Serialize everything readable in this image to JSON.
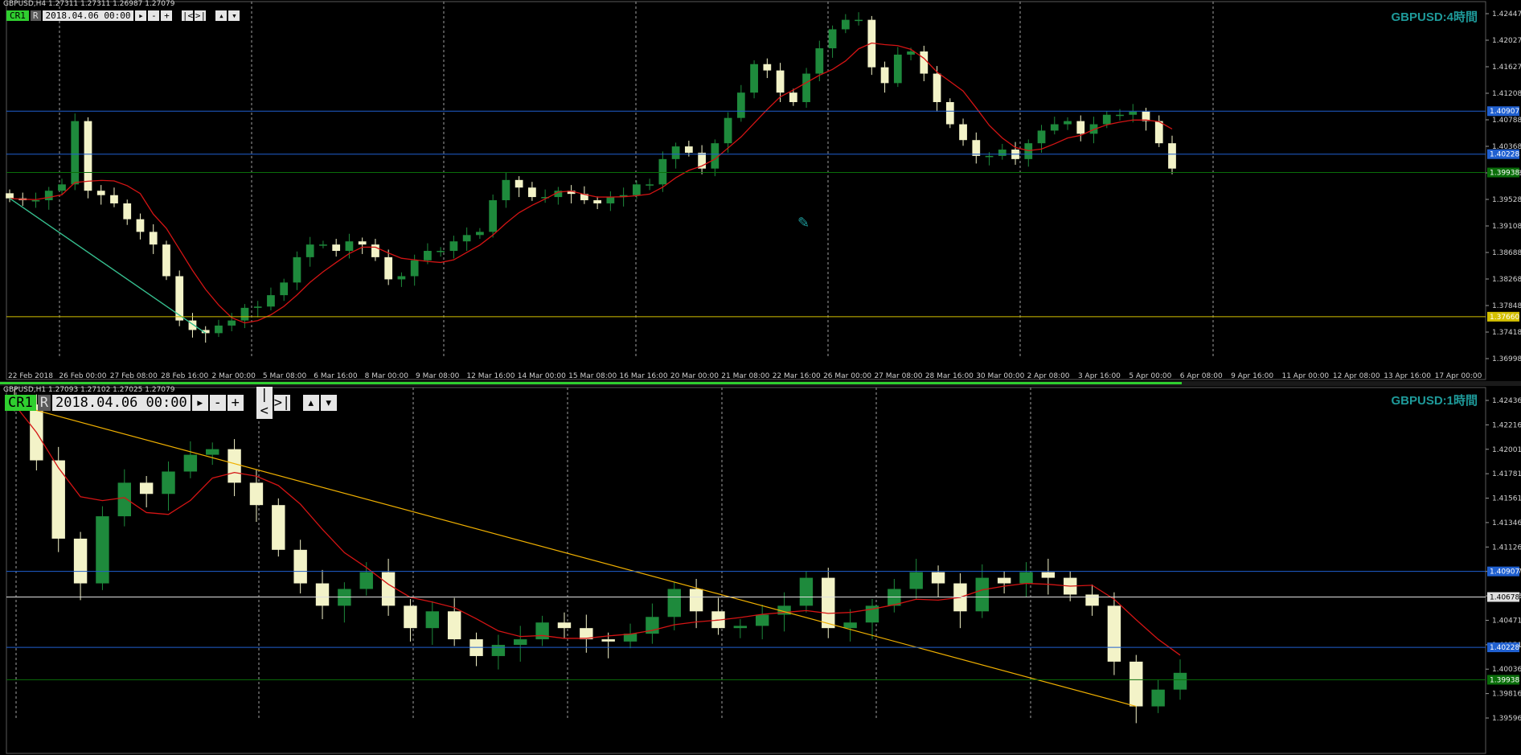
{
  "panes": {
    "h4": {
      "symbol_line": "GBPUSD,H4  1.27311 1.27311 1.26987 1.27079",
      "title": "GBPUSD:4時間",
      "toolbar": {
        "cr": "CR1",
        "r": "R",
        "date": "2018.04.06 00:00",
        "play": "▸",
        "minus": "-",
        "plus": "+",
        "nav_left": "|<",
        "nav_right": ">|",
        "up": "▴",
        "down": "▾"
      },
      "price_ticks": [
        "1.42447",
        "1.42027",
        "1.41627",
        "1.41208",
        "1.40788",
        "1.40368",
        "1.39948",
        "1.39528",
        "1.39108",
        "1.38688",
        "1.38268",
        "1.37848",
        "1.37418",
        "1.36998"
      ],
      "time_labels": [
        "22 Feb 2018",
        "26 Feb 00:00",
        "27 Feb 08:00",
        "28 Feb 16:00",
        "2 Mar 00:00",
        "5 Mar 08:00",
        "6 Mar 16:00",
        "8 Mar 00:00",
        "9 Mar 08:00",
        "12 Mar 16:00",
        "14 Mar 00:00",
        "15 Mar 08:00",
        "16 Mar 16:00",
        "20 Mar 00:00",
        "21 Mar 08:00",
        "22 Mar 16:00",
        "26 Mar 00:00",
        "27 Mar 08:00",
        "28 Mar 16:00",
        "30 Mar 00:00",
        "2 Apr 08:00",
        "3 Apr 16:00",
        "5 Apr 00:00",
        "6 Apr 08:00",
        "9 Apr 16:00",
        "11 Apr 00:00",
        "12 Apr 08:00",
        "13 Apr 16:00",
        "17 Apr 00:00"
      ],
      "hlines": [
        {
          "price": 1.40907,
          "label": "1.40907",
          "color": "#2060d0"
        },
        {
          "price": 1.40228,
          "label": "1.40228",
          "color": "#2060d0"
        },
        {
          "price": 1.39938,
          "label": "1.39938",
          "color": "#0a6e0a"
        },
        {
          "price": 1.3766,
          "label": "1.37660",
          "color": "#d4c000"
        }
      ]
    },
    "h1": {
      "symbol_line": "GBPUSD,H1  1.27093 1.27102 1.27025 1.27079",
      "title": "GBPUSD:1時間",
      "toolbar": {
        "cr": "CR1",
        "r": "R",
        "date": "2018.04.06 00:00",
        "play": "▸",
        "minus": "-",
        "plus": "+",
        "nav_left": "|<",
        "nav_right": ">|",
        "up": "▴",
        "down": "▾"
      },
      "price_ticks": [
        "1.42436",
        "1.42216",
        "1.42001",
        "1.41781",
        "1.41561",
        "1.41346",
        "1.41126",
        "1.40907",
        "1.40678",
        "1.40471",
        "1.40251",
        "1.40036",
        "1.39816",
        "1.39596"
      ],
      "hlines": [
        {
          "price": 1.40907,
          "label": "1.40907",
          "color": "#2060d0"
        },
        {
          "price": 1.40678,
          "label": "1.40678",
          "color": "#e0e0e0"
        },
        {
          "price": 1.40228,
          "label": "1.40228",
          "color": "#2060d0"
        },
        {
          "price": 1.39938,
          "label": "1.39938",
          "color": "#0a6e0a"
        }
      ]
    }
  },
  "colors": {
    "background": "#000000",
    "grid": "#a0a0a0",
    "bull_candle": "#1e8a3c",
    "bear_candle": "#f3f3c8",
    "ma_red": "#d41414",
    "zigzag_yellow": "#f0b000",
    "zigzag_teal": "#20c0a0",
    "title_teal": "#1e9a9a"
  },
  "chart_data": [
    {
      "type": "candlestick",
      "title": "GBPUSD:4時間",
      "timeframe": "H4",
      "ylim": [
        1.36998,
        1.42447
      ],
      "close_path_h4_approx": [
        1.3953,
        1.395,
        1.395,
        1.3965,
        1.3975,
        1.4075,
        1.3965,
        1.3958,
        1.3945,
        1.392,
        1.39,
        1.388,
        1.383,
        1.376,
        1.3745,
        1.374,
        1.3752,
        1.376,
        1.378,
        1.3782,
        1.38,
        1.382,
        1.386,
        1.388,
        1.388,
        1.387,
        1.3885,
        1.388,
        1.386,
        1.3825,
        1.383,
        1.3855,
        1.387,
        1.387,
        1.3885,
        1.3895,
        1.39,
        1.395,
        1.3982,
        1.397,
        1.3955,
        1.3955,
        1.3965,
        1.396,
        1.395,
        1.3945,
        1.3955,
        1.3958,
        1.3975,
        1.3975,
        1.4015,
        1.4035,
        1.4025,
        1.4,
        1.404,
        1.408,
        1.412,
        1.4165,
        1.4155,
        1.412,
        1.4105,
        1.415,
        1.419,
        1.422,
        1.4235,
        1.4235,
        1.416,
        1.4135,
        1.418,
        1.4185,
        1.415,
        1.4105,
        1.407,
        1.4045,
        1.402,
        1.402,
        1.403,
        1.4015,
        1.404,
        1.406,
        1.407,
        1.4075,
        1.4055,
        1.407,
        1.4085,
        1.4085,
        1.409,
        1.4075,
        1.404,
        1.4
      ]
    },
    {
      "type": "candlestick",
      "title": "GBPUSD:1時間",
      "timeframe": "H1",
      "ylim": [
        1.39596,
        1.42436
      ],
      "close_path_h1_approx": [
        1.424,
        1.419,
        1.412,
        1.408,
        1.414,
        1.417,
        1.416,
        1.418,
        1.4195,
        1.42,
        1.417,
        1.415,
        1.411,
        1.408,
        1.406,
        1.4075,
        1.409,
        1.406,
        1.404,
        1.4055,
        1.403,
        1.4015,
        1.4025,
        1.403,
        1.4045,
        1.404,
        1.403,
        1.4028,
        1.4035,
        1.405,
        1.4075,
        1.4055,
        1.404,
        1.4042,
        1.4052,
        1.406,
        1.4085,
        1.404,
        1.4045,
        1.406,
        1.4075,
        1.409,
        1.408,
        1.4055,
        1.4085,
        1.408,
        1.409,
        1.4085,
        1.407,
        1.406,
        1.401,
        1.397,
        1.3985,
        1.4
      ]
    }
  ]
}
